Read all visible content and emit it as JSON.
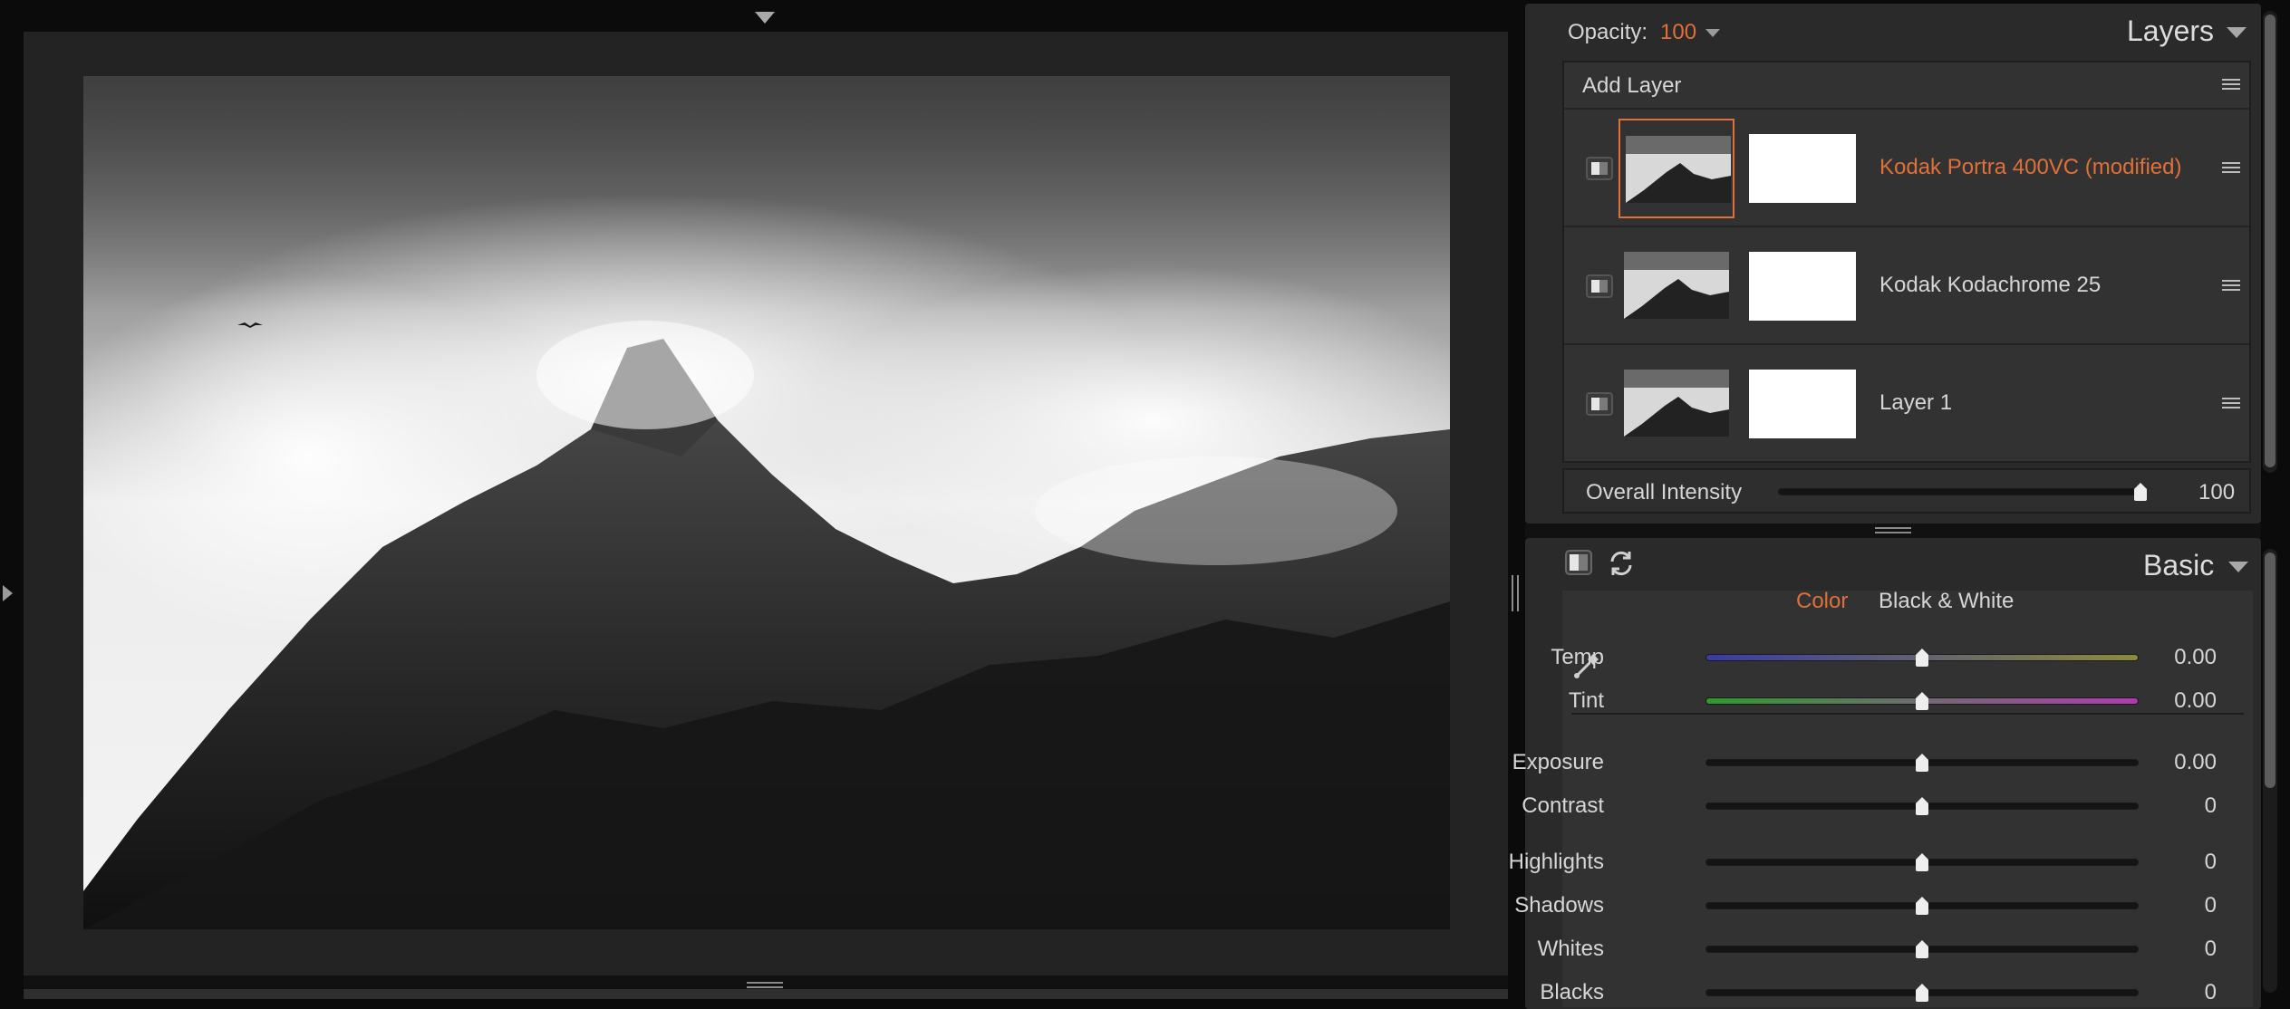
{
  "layers_panel": {
    "opacity_label": "Opacity:",
    "opacity_value": "100",
    "title": "Layers",
    "add_layer_label": "Add Layer",
    "layers": [
      {
        "name": "Kodak Portra 400VC (modified)",
        "selected": true
      },
      {
        "name": "Kodak Kodachrome  25",
        "selected": false
      },
      {
        "name": "Layer 1",
        "selected": false
      }
    ],
    "intensity_label": "Overall Intensity",
    "intensity_value": "100",
    "intensity_level": 1.0
  },
  "basic_panel": {
    "title": "Basic",
    "mode_color": "Color",
    "mode_bw": "Black & White",
    "white_balance": [
      {
        "label": "Temp",
        "value": "0.00",
        "level": 0.5,
        "gradient": [
          "#3a3aa8",
          "#8c8c3a"
        ]
      },
      {
        "label": "Tint",
        "value": "0.00",
        "level": 0.5,
        "gradient": [
          "#2e9a2e",
          "#b03ab0"
        ]
      }
    ],
    "tone": [
      {
        "label": "Exposure",
        "value": "0.00",
        "level": 0.5
      },
      {
        "label": "Contrast",
        "value": "0",
        "level": 0.5
      },
      {
        "label": "Highlights",
        "value": "0",
        "level": 0.5
      },
      {
        "label": "Shadows",
        "value": "0",
        "level": 0.5
      },
      {
        "label": "Whites",
        "value": "0",
        "level": 0.5
      },
      {
        "label": "Blacks",
        "value": "0",
        "level": 0.5
      }
    ]
  },
  "colors": {
    "accent": "#e0703a",
    "panel_bg": "#2a2a2a",
    "canvas_bg": "#232323"
  },
  "icons": {
    "opacity_dropdown": "caret-down-icon",
    "panel_menu": "hamburger-icon",
    "layer_visibility": "split-square-icon",
    "reset": "refresh-icon",
    "eyedropper": "eyedropper-icon"
  }
}
